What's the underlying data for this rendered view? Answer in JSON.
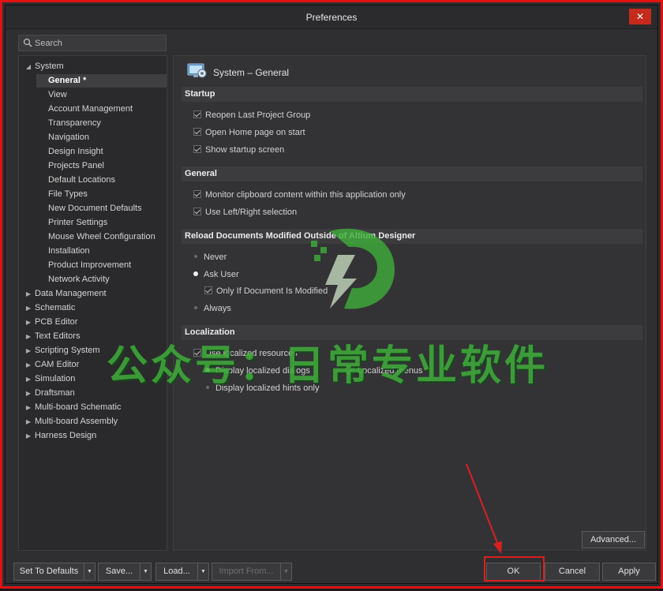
{
  "window": {
    "title": "Preferences",
    "close_glyph": "✕"
  },
  "search": {
    "placeholder": "Search",
    "icon": "search-icon"
  },
  "tree": {
    "system": {
      "label": "System",
      "children": [
        "General *",
        "View",
        "Account Management",
        "Transparency",
        "Navigation",
        "Design Insight",
        "Projects Panel",
        "Default Locations",
        "File Types",
        "New Document Defaults",
        "Printer Settings",
        "Mouse Wheel Configuration",
        "Installation",
        "Product Improvement",
        "Network Activity"
      ]
    },
    "top_items": [
      "Data Management",
      "Schematic",
      "PCB Editor",
      "Text Editors",
      "Scripting System",
      "CAM Editor",
      "Simulation",
      "Draftsman",
      "Multi-board Schematic",
      "Multi-board Assembly",
      "Harness Design"
    ]
  },
  "page": {
    "title": "System – General",
    "sections": {
      "startup": {
        "label": "Startup",
        "options": [
          "Reopen Last Project Group",
          "Open Home page on start",
          "Show startup screen"
        ]
      },
      "general": {
        "label": "General",
        "options": [
          "Monitor clipboard content within this application only",
          "Use Left/Right selection"
        ]
      },
      "reload": {
        "label": "Reload Documents Modified Outside of Altium Designer",
        "options": [
          "Never",
          "Ask User",
          "Only If Document Is Modified",
          "Always"
        ]
      },
      "localization": {
        "label": "Localization",
        "options": [
          "Use localized resources",
          "Display localized dialogs",
          "Localized menus",
          "Display localized hints only"
        ]
      }
    },
    "advanced_label": "Advanced..."
  },
  "footer": {
    "set_defaults": "Set To Defaults",
    "save": "Save...",
    "load": "Load...",
    "import": "Import From...",
    "ok": "OK",
    "cancel": "Cancel",
    "apply": "Apply"
  },
  "watermark": {
    "text": "公众号：日常专业软件",
    "color": "#3fae3a"
  },
  "colors": {
    "highlight_red": "#d92020",
    "window_border": "#e01212"
  }
}
